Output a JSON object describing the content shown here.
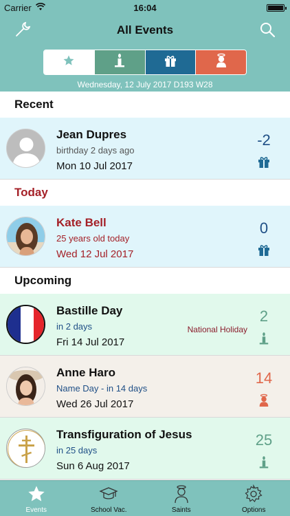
{
  "status": {
    "carrier": "Carrier",
    "time": "16:04"
  },
  "nav": {
    "title": "All Events"
  },
  "filters": [
    {
      "id": "all",
      "icon": "star-icon"
    },
    {
      "id": "holidays",
      "icon": "candle-icon"
    },
    {
      "id": "birthdays",
      "icon": "gift-icon"
    },
    {
      "id": "saints",
      "icon": "saint-icon"
    }
  ],
  "dateline": "Wednesday, 12 July 2017  D193 W28",
  "sections": {
    "recent": "Recent",
    "today": "Today",
    "upcoming": "Upcoming"
  },
  "events": [
    {
      "name": "Jean Dupres",
      "subtitle": "birthday 2 days ago",
      "date": "Mon 10 Jul 2017",
      "count": "-2",
      "kind": "gift-icon",
      "tag": ""
    },
    {
      "name": "Kate Bell",
      "subtitle": "25 years old today",
      "date": "Wed 12 Jul 2017",
      "count": "0",
      "kind": "gift-icon",
      "tag": ""
    },
    {
      "name": "Bastille Day",
      "subtitle": "in 2 days",
      "date": "Fri 14 Jul 2017",
      "count": "2",
      "kind": "candle-icon",
      "tag": "National Holiday"
    },
    {
      "name": "Anne Haro",
      "subtitle": "Name Day - in 14 days",
      "date": "Wed 26 Jul 2017",
      "count": "14",
      "kind": "saint-icon",
      "tag": ""
    },
    {
      "name": "Transfiguration of Jesus",
      "subtitle": "in 25 days",
      "date": "Sun 6 Aug 2017",
      "count": "25",
      "kind": "candle-icon",
      "tag": ""
    }
  ],
  "colors": {
    "header": "#7fc2bc",
    "holiday": "#5fa088",
    "birthday": "#1f6a94",
    "saint": "#e0674b",
    "today_red": "#a42027"
  },
  "tabs": [
    {
      "label": "Events",
      "icon": "star-icon"
    },
    {
      "label": "School Vac.",
      "icon": "graduation-cap-icon"
    },
    {
      "label": "Saints",
      "icon": "saint-icon"
    },
    {
      "label": "Options",
      "icon": "gear-icon"
    }
  ]
}
